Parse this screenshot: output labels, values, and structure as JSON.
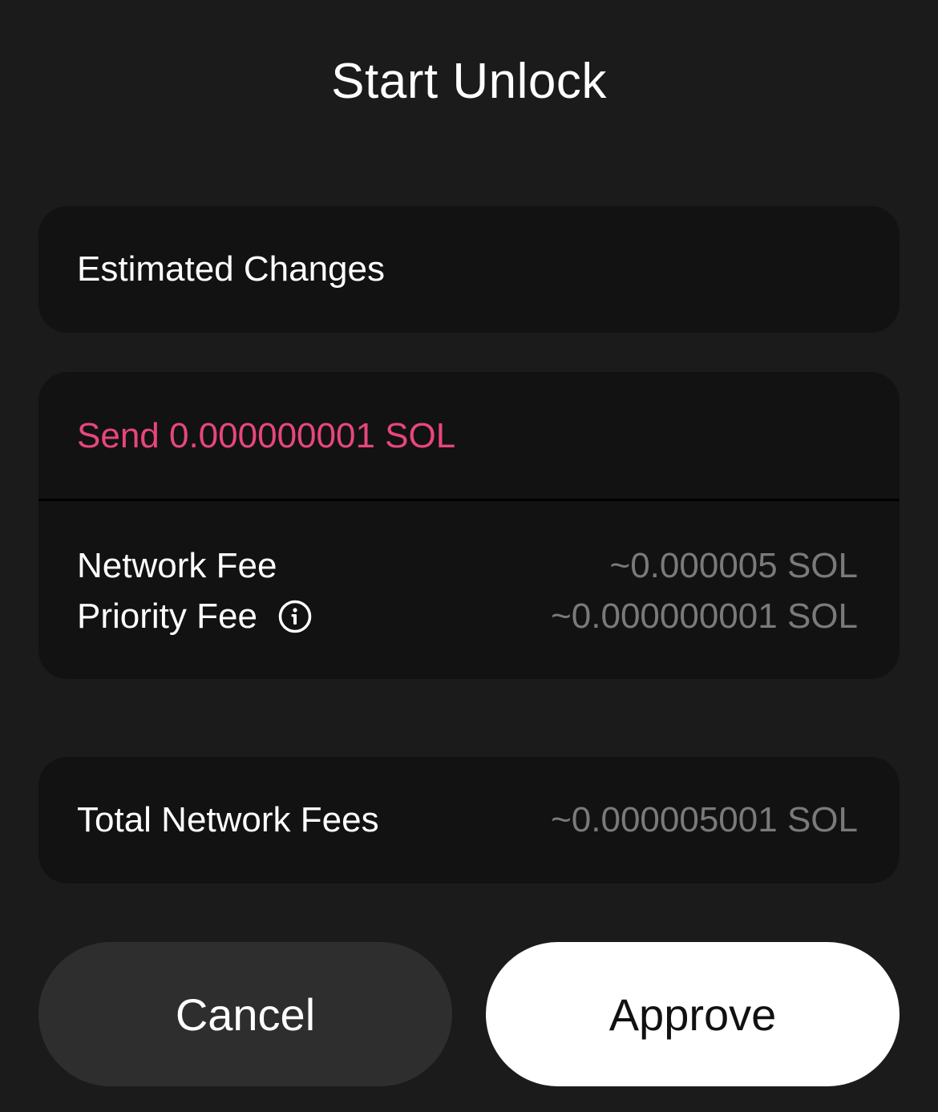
{
  "header": {
    "title": "Start Unlock"
  },
  "estimated_changes": {
    "label": "Estimated Changes"
  },
  "details": {
    "send_text": "Send 0.000000001 SOL",
    "network_fee_label": "Network Fee",
    "network_fee_value": "~0.000005 SOL",
    "priority_fee_label": "Priority Fee",
    "priority_fee_value": "~0.000000001 SOL",
    "info_icon": "info-icon"
  },
  "total": {
    "label": "Total Network Fees",
    "value": "~0.000005001 SOL"
  },
  "actions": {
    "cancel_label": "Cancel",
    "approve_label": "Approve"
  },
  "colors": {
    "background": "#1b1b1b",
    "card": "#121212",
    "send_accent": "#e8467c",
    "muted_value": "#7a7a7a",
    "cancel_button": "#2e2e2e",
    "approve_button": "#ffffff"
  }
}
